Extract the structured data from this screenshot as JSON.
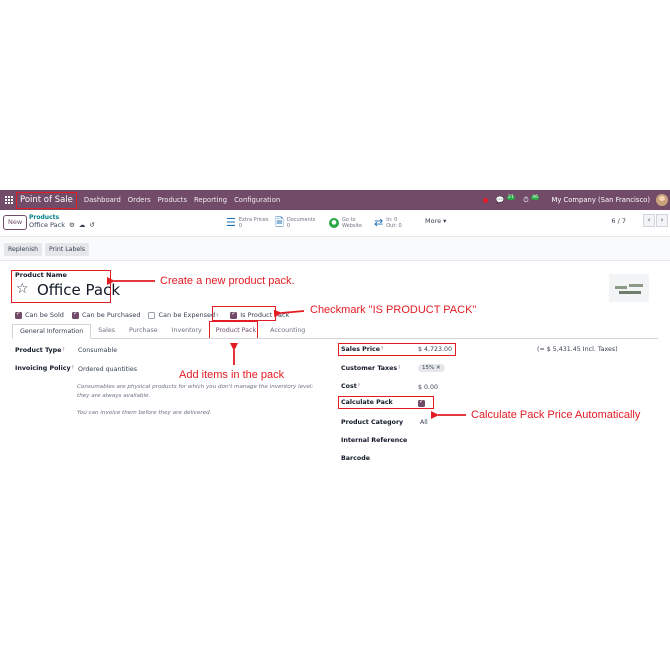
{
  "navbar": {
    "app": "Point of Sale",
    "menu": [
      "Dashboard",
      "Orders",
      "Products",
      "Reporting",
      "Configuration"
    ],
    "messages_count": "21",
    "activities_count": "46",
    "company": "My Company (San Francisco)"
  },
  "control_panel": {
    "new_label": "New",
    "breadcrumb_parent": "Products",
    "breadcrumb_current": "Office Pack",
    "smart_buttons": [
      {
        "label": "Extra Prices",
        "value": "0"
      },
      {
        "label": "Documents",
        "value": "0"
      },
      {
        "label": "Go to",
        "value": "Website"
      },
      {
        "label": "In: 0",
        "value": "Out: 0"
      }
    ],
    "more_label": "More ▾",
    "pager": "6 / 7"
  },
  "actions": [
    "Replenish",
    "Print Labels"
  ],
  "form": {
    "name_label": "Product Name",
    "name": "Office Pack",
    "checkboxes": [
      {
        "label": "Can be Sold",
        "checked": true
      },
      {
        "label": "Can be Purchased",
        "checked": true
      },
      {
        "label": "Can be Expensed",
        "checked": false,
        "help": "?"
      },
      {
        "label": "Is Product Pack",
        "checked": true
      }
    ],
    "tabs": [
      "General Information",
      "Sales",
      "Purchase",
      "Inventory",
      "Product Pack",
      "Accounting"
    ],
    "left_fields": {
      "product_type_label": "Product Type",
      "product_type": "Consumable",
      "invoicing_policy_label": "Invoicing Policy",
      "invoicing_policy": "Ordered quantities",
      "note1": "Consumables are physical products for which you don't manage the inventory level: they are always available.",
      "note2": "You can invoice them before they are delivered."
    },
    "right_fields": {
      "sales_price_label": "Sales Price",
      "sales_price": "$ 4,723.00",
      "incl_taxes": "(= $ 5,431.45 Incl. Taxes)",
      "customer_taxes_label": "Customer Taxes",
      "customer_taxes": "15% ✕",
      "cost_label": "Cost",
      "cost": "$ 0.00",
      "calculate_pack_label": "Calculate Pack",
      "calculate_pack": true,
      "product_category_label": "Product Category",
      "product_category": "All",
      "internal_reference_label": "Internal Reference",
      "barcode_label": "Barcode"
    }
  },
  "annotations": {
    "create": "Create a new product pack.",
    "is_pack": "Checkmark \"IS PRODUCT PACK\"",
    "add_items": "Add items in the pack",
    "calc": "Calculate Pack Price Automatically"
  },
  "colors": {
    "brand": "#714b67",
    "annotation": "#e31b23",
    "link": "#017e84"
  }
}
